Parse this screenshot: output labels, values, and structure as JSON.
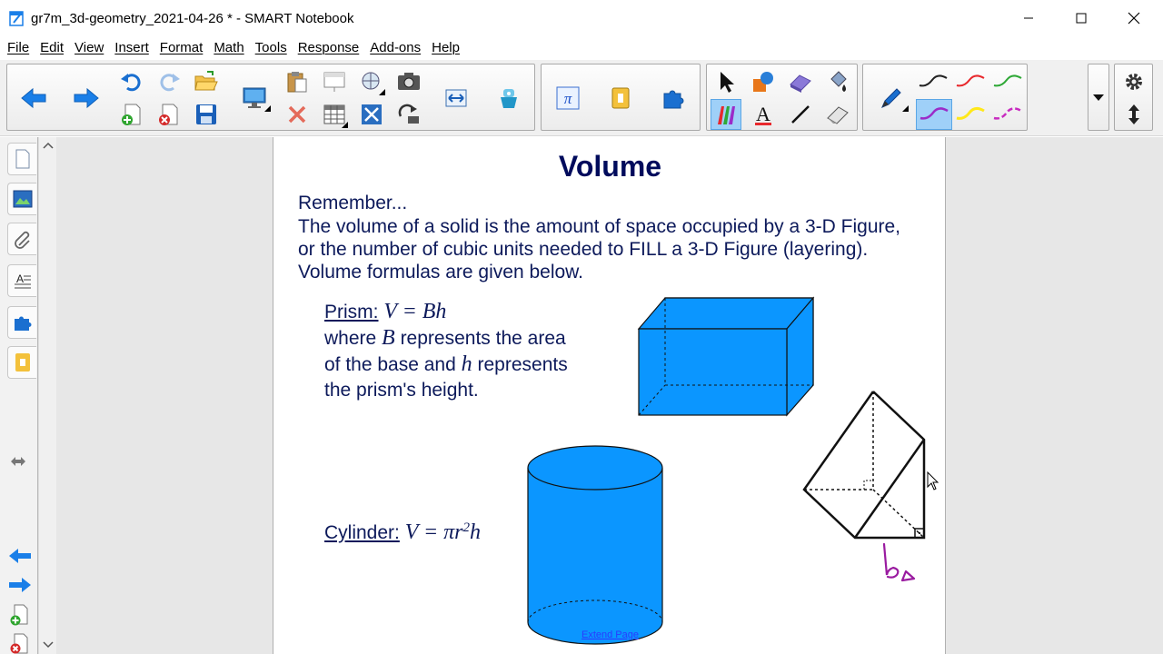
{
  "window": {
    "title": "gr7m_3d-geometry_2021-04-26 * - SMART Notebook"
  },
  "menu": [
    {
      "label": "File"
    },
    {
      "label": "Edit"
    },
    {
      "label": "View"
    },
    {
      "label": "Insert"
    },
    {
      "label": "Format"
    },
    {
      "label": "Math"
    },
    {
      "label": "Tools"
    },
    {
      "label": "Response"
    },
    {
      "label": "Add-ons"
    },
    {
      "label": "Help"
    }
  ],
  "toolbar_icons": [
    "back-arrow-icon",
    "forward-arrow-icon",
    "undo-icon",
    "redo-icon",
    "open-folder-icon",
    "add-page-icon",
    "delete-page-icon",
    "save-icon",
    "screen-share-icon",
    "paste-icon",
    "screen-shade-icon",
    "capture-icon",
    "camera-icon",
    "delete-icon",
    "table-icon",
    "fullscreen-icon",
    "rotate-icon",
    "dual-page-icon",
    "response-icon",
    "pi-icon",
    "addon-icon",
    "puzzle-icon",
    "select-arrow-icon",
    "shapes-icon",
    "eraser-shape-icon",
    "fill-icon",
    "pen-icon",
    "creative-pens-icon",
    "text-icon",
    "line-icon",
    "eraser-icon",
    "settings-gear-icon",
    "move-toolbar-icon"
  ],
  "colors": {
    "accent": "#1a7fe8",
    "shape_fill": "#0b96ff",
    "navy_text": "#0d1a5b",
    "ink_purple": "#9a1ba0",
    "pen_black": "#222222",
    "pen_red": "#e8282c",
    "pen_green": "#2ea836",
    "pen_purple": "#9b2cc8",
    "pen_yellow": "#ffe81a",
    "pen_magenta": "#c82cc0"
  },
  "page": {
    "title": "Volume",
    "remember": "Remember...",
    "intro": "The volume of a solid is the amount of space occupied by a 3-D Figure, or the number of cubic units needed to FILL a 3-D Figure (layering).  Volume formulas are given below.",
    "prism_label": "Prism:",
    "prism_formula": "V = Bh",
    "prism_text_1": "where",
    "prism_var_b": "B",
    "prism_text_2": "represents the area of the base and",
    "prism_var_h": "h",
    "prism_text_3": "represents the prism's height.",
    "cylinder_label": "Cylinder:",
    "cylinder_formula_a": "V = πr",
    "cylinder_exp": "2",
    "cylinder_formula_b": "h",
    "handwriting": "b△",
    "extend_link": "Extend Page"
  }
}
